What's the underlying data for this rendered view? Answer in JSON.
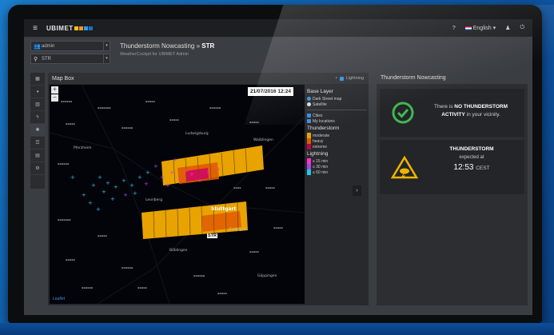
{
  "topbar": {
    "brand": "UBIMET",
    "brand_colors": [
      "#f7c21c",
      "#f7941d",
      "#2d9be8",
      "#1e6fc4"
    ],
    "help": "?",
    "language": "English"
  },
  "selectors": {
    "user": "admin",
    "location": "STR"
  },
  "header": {
    "title_prefix": "Thunderstorm Nowcasting »",
    "title_station": "STR",
    "subtitle": "WeatherCockpit for UBIMET Admin"
  },
  "map_panel": {
    "title": "Map Box",
    "lightning_toggle": "Lightning",
    "timestamp": "21/07/2016 12:24",
    "station_label": "STR",
    "city_label": "Stuttgart",
    "cities": [
      "Pforzheim",
      "Ludwigsburg",
      "Stuttgart",
      "Esslingen",
      "Leonberg",
      "Böblingen",
      "Waiblingen",
      "Göppingen"
    ],
    "credit": "Leaflet"
  },
  "legend": {
    "base_layer_title": "Base Layer",
    "base_layers": [
      {
        "label": "Dark Street map",
        "selected": true
      },
      {
        "label": "Satellite",
        "selected": false
      }
    ],
    "overlays": [
      "Cities",
      "My locations"
    ],
    "thunderstorm_title": "Thunderstorm",
    "thunderstorm_levels": [
      {
        "label": "moderate",
        "color": "#e8a300"
      },
      {
        "label": "heavy",
        "color": "#e05a00"
      },
      {
        "label": "extreme",
        "color": "#c0004a"
      }
    ],
    "lightning_title": "Lightning",
    "lightning_levels": [
      {
        "label": "≤ 15 min",
        "color": "#ff2fd0"
      },
      {
        "label": "≤ 30 min",
        "color": "#a845e0"
      },
      {
        "label": "≤ 60 min",
        "color": "#22c6e0"
      }
    ]
  },
  "right_panel": {
    "title": "Thunderstorm Nowcasting",
    "status_prefix": "There is",
    "status_highlight": "NO THUNDERSTORM",
    "status_line2_highlight": "ACTIVITY",
    "status_suffix": "in your vicinity.",
    "forecast_title": "THUNDERSTORM",
    "forecast_expected": "expected at",
    "forecast_time": "12:53",
    "forecast_tz": "CEST"
  },
  "sidebar": {
    "items": [
      "dashboard-icon",
      "globe-icon",
      "chart-icon",
      "bolt-icon",
      "gear-icon",
      "list-icon",
      "calendar-icon",
      "cogs-icon"
    ]
  }
}
